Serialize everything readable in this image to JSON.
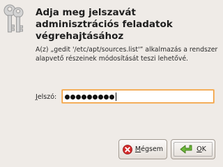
{
  "dialog": {
    "heading": "Adja meg jelszavát adminisztrációs feladatok végrehajtásához",
    "message": "A(z) „gedit '/etc/apt/sources.list'” alkalmazás a rendszer alapvető részeinek módosítását teszi lehetővé.",
    "icon": "keys-icon"
  },
  "password": {
    "label_mnemonic": "J",
    "label_rest": "elszó:",
    "masked_char_count": 9
  },
  "buttons": {
    "cancel": {
      "label_mnemonic": "M",
      "label_rest": "égsem",
      "icon": "cancel-icon",
      "icon_color": "#d42a2a"
    },
    "ok": {
      "label_mnemonic": "O",
      "label_rest": "K",
      "icon": "ok-arrow-icon",
      "icon_color": "#5aa02c"
    }
  },
  "colors": {
    "background": "#efebe7",
    "focus_border": "#f09a36"
  }
}
